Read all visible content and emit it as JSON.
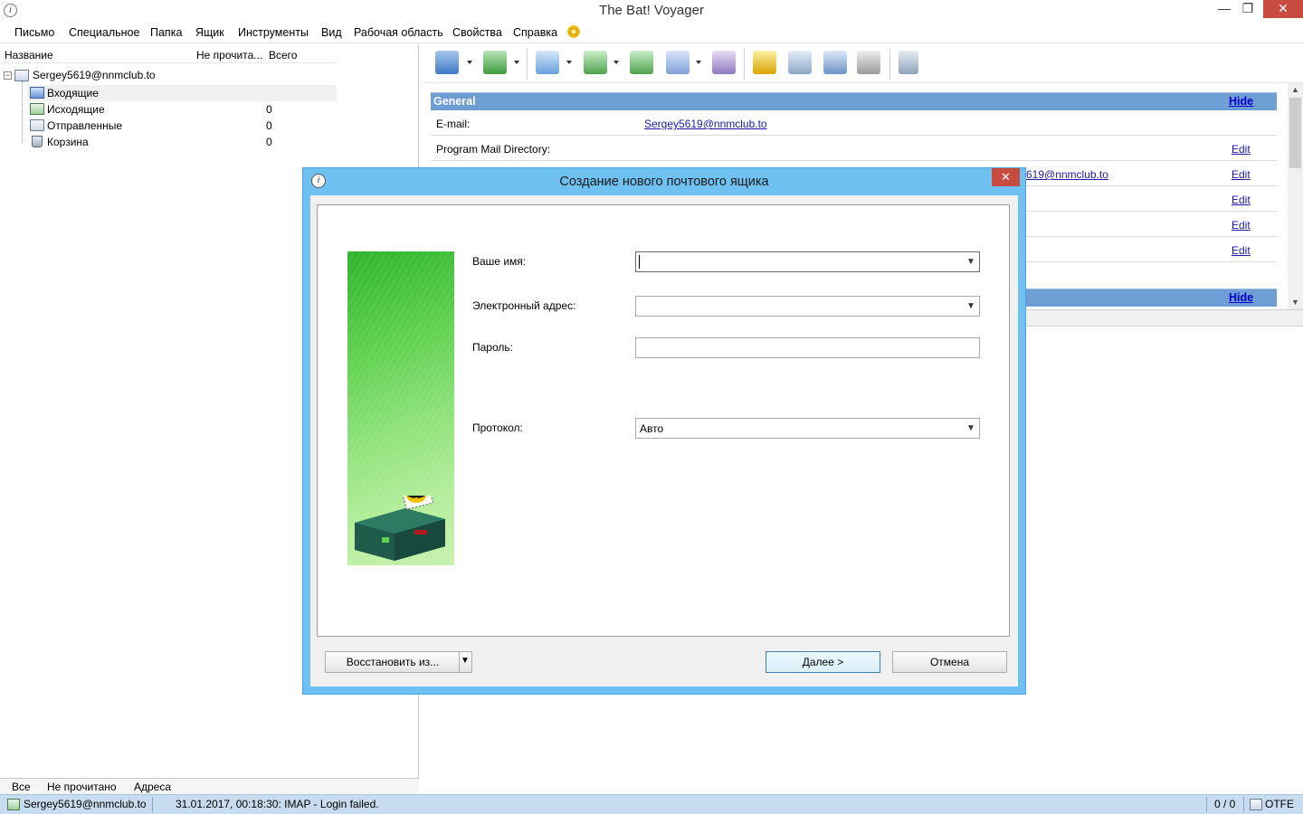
{
  "window": {
    "title": "The Bat! Voyager",
    "min": "—",
    "max": "❐",
    "close": "✕"
  },
  "menu": [
    "Письмо",
    "Специальное",
    "Папка",
    "Ящик",
    "Инструменты",
    "Вид",
    "Рабочая область",
    "Свойства",
    "Справка"
  ],
  "folders": {
    "columns": {
      "name": "Название",
      "unread": "Не прочита...",
      "total": "Всего"
    },
    "account": "Sergey5619@nnmclub.to",
    "items": [
      {
        "label": "Входящие",
        "count": ""
      },
      {
        "label": "Исходящие",
        "count": "0"
      },
      {
        "label": "Отправленные",
        "count": "0"
      },
      {
        "label": "Корзина",
        "count": "0"
      }
    ]
  },
  "bottom_tabs": [
    "Все",
    "Не прочитано",
    "Адреса"
  ],
  "status": {
    "account": "Sergey5619@nnmclub.to",
    "message": "31.01.2017, 00:18:30: IMAP  - Login failed.",
    "counter": "0 / 0",
    "mode": "OTFE"
  },
  "info": {
    "section1": "General",
    "hide": "Hide",
    "rows": [
      {
        "label": "E-mail:",
        "value": "Sergey5619@nnmclub.to",
        "edit": ""
      },
      {
        "label": "Program Mail Directory:",
        "value": "",
        "edit": "Edit"
      },
      {
        "label": "",
        "value": "619@nnmclub.to",
        "edit": "Edit"
      },
      {
        "label": "",
        "value": "",
        "edit": "Edit"
      },
      {
        "label": "",
        "value": "",
        "edit": "Edit"
      },
      {
        "label": "",
        "value": "",
        "edit": "Edit"
      }
    ],
    "hide2": "Hide"
  },
  "dialog": {
    "title": "Создание нового почтового ящика",
    "close": "✕",
    "fields": {
      "name_label": "Ваше имя:",
      "name_value": "",
      "email_label": "Электронный адрес:",
      "email_value": "",
      "password_label": "Пароль:",
      "password_value": "",
      "protocol_label": "Протокол:",
      "protocol_value": "Авто"
    },
    "buttons": {
      "restore": "Восстановить из...",
      "next": "Далее   >",
      "cancel": "Отмена"
    }
  },
  "colors": {
    "accent_blue": "#6ec1f0",
    "section_header": "#6e9ed3",
    "status_bar": "#c8dcef",
    "close_red": "#c74b3f"
  }
}
